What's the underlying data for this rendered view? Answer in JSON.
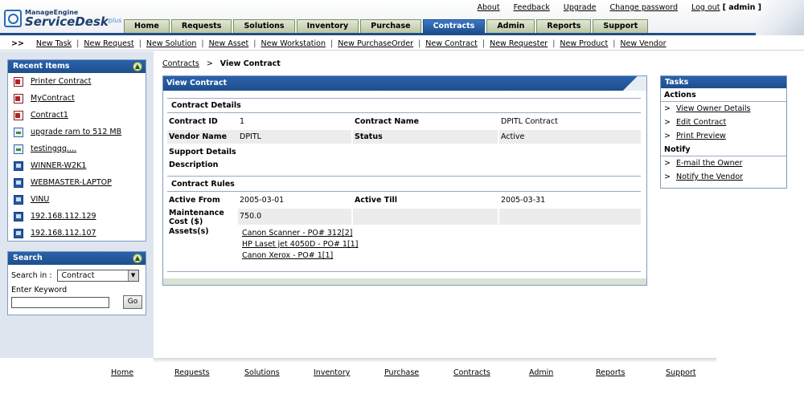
{
  "app": {
    "logo_top": "ManageEngine",
    "logo_main": "ServiceDesk",
    "logo_plus": "plus"
  },
  "toplinks": {
    "about": "About",
    "feedback": "Feedback",
    "upgrade": "Upgrade",
    "change_password": "Change password",
    "logout": "Log out",
    "user": "[ admin ]"
  },
  "tabs": [
    "Home",
    "Requests",
    "Solutions",
    "Inventory",
    "Purchase",
    "Contracts",
    "Admin",
    "Reports",
    "Support"
  ],
  "active_tab": "Contracts",
  "quickbar": {
    "arrows": ">>",
    "links": [
      "New Task",
      "New Request",
      "New Solution",
      "New Asset",
      "New Workstation",
      "New PurchaseOrder",
      "New Contract",
      "New Requester",
      "New Product",
      "New Vendor"
    ]
  },
  "recent": {
    "title": "Recent Items",
    "items": [
      {
        "label": "Printer Contract",
        "icon": "contract-icon"
      },
      {
        "label": "MyContract",
        "icon": "contract-icon"
      },
      {
        "label": "Contract1",
        "icon": "contract-icon"
      },
      {
        "label": "upgrade ram to 512 MB",
        "icon": "request-icon"
      },
      {
        "label": "testingqq....",
        "icon": "request-icon"
      },
      {
        "label": "WINNER-W2K1",
        "icon": "computer-icon"
      },
      {
        "label": "WEBMASTER-LAPTOP",
        "icon": "computer-icon"
      },
      {
        "label": "VINU",
        "icon": "computer-icon"
      },
      {
        "label": "192.168.112.129",
        "icon": "computer-icon"
      },
      {
        "label": "192.168.112.107",
        "icon": "computer-icon"
      }
    ]
  },
  "search": {
    "title": "Search",
    "search_in_label": "Search in :",
    "search_in_value": "Contract",
    "keyword_label": "Enter Keyword",
    "keyword_value": "",
    "go_label": "Go"
  },
  "breadcrumb": {
    "parent": "Contracts",
    "arrow": ">",
    "current": "View Contract"
  },
  "contract": {
    "header": "View Contract",
    "details_title": "Contract Details",
    "contract_id_label": "Contract ID",
    "contract_id": "1",
    "contract_name_label": "Contract Name",
    "contract_name": "DPITL Contract",
    "vendor_name_label": "Vendor Name",
    "vendor_name": "DPITL",
    "status_label": "Status",
    "status": "Active",
    "support_details_label": "Support Details",
    "description_label": "Description",
    "rules_title": "Contract Rules",
    "active_from_label": "Active From",
    "active_from": "2005-03-01",
    "active_till_label": "Active Till",
    "active_till": "2005-03-31",
    "maintenance_cost_label": "Maintenance Cost ($)",
    "maintenance_cost": "750.0",
    "assets_label": "Assets(s)",
    "assets": [
      "Canon Scanner - PO# 312[2]",
      "HP Laset jet 4050D - PO# 1[1]",
      "Canon Xerox - PO# 1[1]"
    ]
  },
  "tasks": {
    "title": "Tasks",
    "actions_title": "Actions",
    "actions": [
      "View Owner Details",
      "Edit Contract",
      "Print Preview"
    ],
    "notify_title": "Notify",
    "notify": [
      "E-mail the Owner",
      "Notify the Vendor"
    ],
    "bullet": ">"
  },
  "footer": [
    "Home",
    "Requests",
    "Solutions",
    "Inventory",
    "Purchase",
    "Contracts",
    "Admin",
    "Reports",
    "Support"
  ]
}
